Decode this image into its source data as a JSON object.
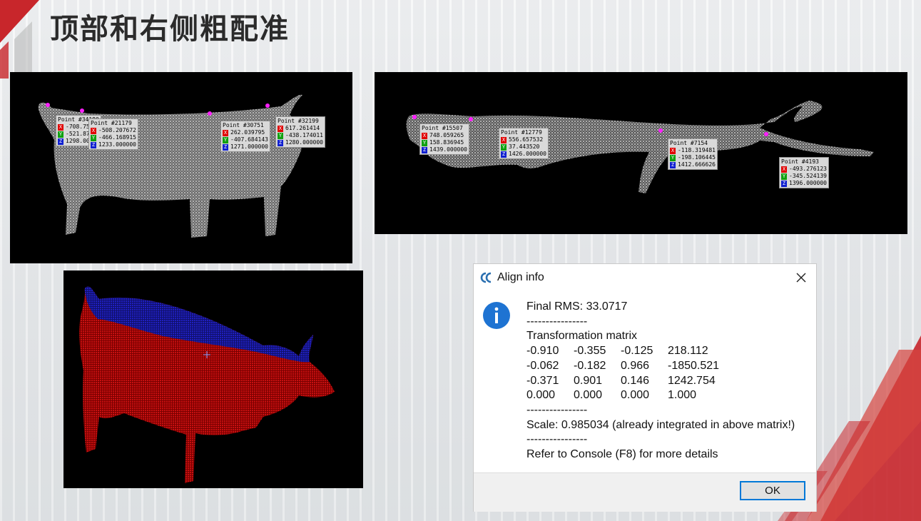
{
  "slide": {
    "title": "顶部和右侧粗配准"
  },
  "panels": {
    "side_view": {
      "labels": [
        {
          "point": "Point #34180",
          "x": "-708.75",
          "y": "-521.87",
          "z": "1298.00"
        },
        {
          "point": "Point #21179",
          "x": "-508.207672",
          "y": "-466.168915",
          "z": "1233.000000"
        },
        {
          "point": "Point #30751",
          "x": "262.039795",
          "y": "-407.684143",
          "z": "1271.000000"
        },
        {
          "point": "Point #32199",
          "x": "617.261414",
          "y": "-438.174011",
          "z": "1280.000000"
        }
      ]
    },
    "top_view": {
      "labels": [
        {
          "point": "Point #15507",
          "x": "748.059265",
          "y": "158.836945",
          "z": "1439.000000"
        },
        {
          "point": "Point #12779",
          "x": "556.657532",
          "y": "37.443520",
          "z": "1426.000000"
        },
        {
          "point": "Point #7154",
          "x": "-118.319481",
          "y": "-198.106445",
          "z": "1412.666626"
        },
        {
          "point": "Point #4193",
          "x": "-493.276123",
          "y": "-345.524139",
          "z": "1396.000000"
        }
      ]
    },
    "axis_letters": {
      "x": "X",
      "y": "Y",
      "z": "Z"
    }
  },
  "dialog": {
    "title": "Align info",
    "app_icon": "cloudcompare-icon",
    "info_icon": "info-icon",
    "rms": "Final RMS: 33.0717",
    "sep1": "----------------",
    "matrix_heading": "Transformation matrix",
    "matrix": [
      [
        "-0.910",
        "-0.355",
        "-0.125",
        "218.112"
      ],
      [
        "-0.062",
        "-0.182",
        "0.966",
        "-1850.521"
      ],
      [
        "-0.371",
        "0.901",
        "0.146",
        "1242.754"
      ],
      [
        "0.000",
        "0.000",
        "0.000",
        "1.000"
      ]
    ],
    "sep2": "----------------",
    "scale": "Scale: 0.985034 (already integrated in above matrix!)",
    "sep3": "----------------",
    "console_hint": "Refer to Console (F8) for more details",
    "ok_label": "OK"
  },
  "colors": {
    "accent_red": "#c8262b",
    "dialog_focus": "#0078d7",
    "point_marker": "#ff20ff",
    "cloud_target": "#ff1a1a",
    "cloud_source": "#2a2aff"
  }
}
